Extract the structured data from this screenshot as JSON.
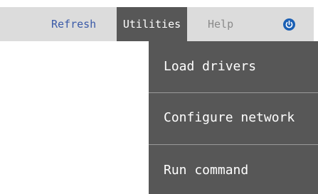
{
  "menubar": {
    "refresh_label": "Refresh",
    "utilities_label": "Utilities",
    "help_label": "Help",
    "power_icon": "power-icon"
  },
  "utilities_menu": {
    "items": [
      {
        "label": "Load drivers"
      },
      {
        "label": "Configure network"
      },
      {
        "label": "Run command"
      }
    ]
  },
  "colors": {
    "menubar_bg": "#dcdcdc",
    "active_menu_bg": "#575757",
    "dropdown_bg": "#575757",
    "refresh_text": "#3a5aa8",
    "help_text": "#8a8a8a",
    "power_icon": "#1a5fb4",
    "divider": "#9a9a9a"
  }
}
